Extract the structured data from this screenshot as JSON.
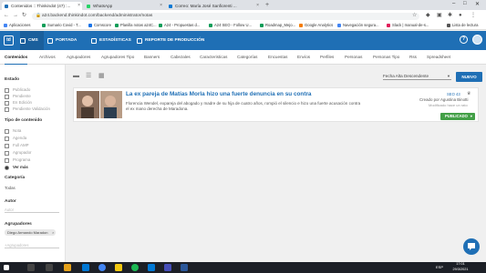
{
  "browser": {
    "tabs": [
      {
        "label": "Contenidos :: Thinkindot (47) :...",
        "color": "#1f6fb5",
        "active": true
      },
      {
        "label": "WhatsApp",
        "color": "#25d366",
        "active": false
      },
      {
        "label": "Correo: María José Sanfiorenti ...",
        "color": "#0078d4",
        "active": false
      }
    ],
    "new_tab_glyph": "+",
    "url": "a24.backend.thinkindot.com/backend/administrator/notas",
    "bookmarks": [
      {
        "label": "Aplicaciones",
        "color": "#4285f4"
      },
      {
        "label": "Sumario Covid - T...",
        "color": "#0f9d58"
      },
      {
        "label": "Comscore",
        "color": "#1a73e8"
      },
      {
        "label": "Planilla notas a24C...",
        "color": "#0f9d58"
      },
      {
        "label": "A24 - Propuestas d...",
        "color": "#0f9d58"
      },
      {
        "label": "A24 SEO - Follow U...",
        "color": "#0f9d58"
      },
      {
        "label": "Roadmap_Mejo...",
        "color": "#0f9d58"
      },
      {
        "label": "Google Analytics",
        "color": "#f57c00"
      },
      {
        "label": "Navegación segura...",
        "color": "#4285f4"
      },
      {
        "label": "Slack | manual-de-s...",
        "color": "#e01e5a"
      },
      {
        "label": "Lista de lectura",
        "color": "#555555"
      }
    ]
  },
  "appbar": {
    "logo": "td",
    "items": [
      {
        "label": "CMS",
        "active": true
      },
      {
        "label": "PORTADA",
        "active": false
      },
      {
        "label": "ESTADÍSTICAS",
        "active": false
      },
      {
        "label": "REPORTE DE PRODUCCIÓN",
        "active": false
      }
    ],
    "help": "?"
  },
  "subnav": [
    "Contenidos",
    "Archivos",
    "Agrupadores",
    "Agrupadores Tipo",
    "Banners",
    "Cabezales",
    "Caracteristicas",
    "Categorías",
    "Encuestas",
    "Envíos",
    "Perfiles",
    "Personas",
    "Personas Tipo",
    "Rss",
    "Spreadsheet"
  ],
  "sidebar": {
    "estado_title": "Estado",
    "estado": [
      "Publicado",
      "Pendiente",
      "En Edición",
      "Pendiente Validación"
    ],
    "tipo_title": "Tipo de contenido",
    "tipo": [
      "Nota",
      "Agenda",
      "Full AMP",
      "Agrupador",
      "Programa"
    ],
    "ver_mas": "Ver más",
    "categoria_title": "Categoría",
    "categoria_value": "Todas",
    "autor_title": "Autor",
    "autor_placeholder": "Autor",
    "agrupadores_title": "Agrupadores",
    "agrupador_chip": "Diego Armando Maradon",
    "agrupadores_placeholder": "+Agrupadores"
  },
  "toolbar": {
    "sort_value": "Fecha Alta Descendente",
    "new_button": "NUEVO"
  },
  "article": {
    "title": "La ex pareja de Matías Morla hizo una fuerte denuncia en su contra",
    "excerpt": "Florencia Wendel, expareja del abogado y madre de su hija de cuatro años, rompió el silencio e hizo una fuerte acusación contra el ex mano derecha de Maradona.",
    "seo_badge": "SEO 43",
    "author_line": "Creado por Agustina Binotti",
    "modified_line": "Modificado hace un rato",
    "status_button": "PUBLICADO"
  },
  "taskbar": {
    "time": "17:01",
    "date": "29/3/2021",
    "lang": "ESP"
  },
  "icons": {
    "back": "back-arrow-icon",
    "forward": "forward-arrow-icon",
    "reload": "reload-icon",
    "lock": "lock-icon",
    "star": "star-icon",
    "chat": "chat-icon"
  }
}
